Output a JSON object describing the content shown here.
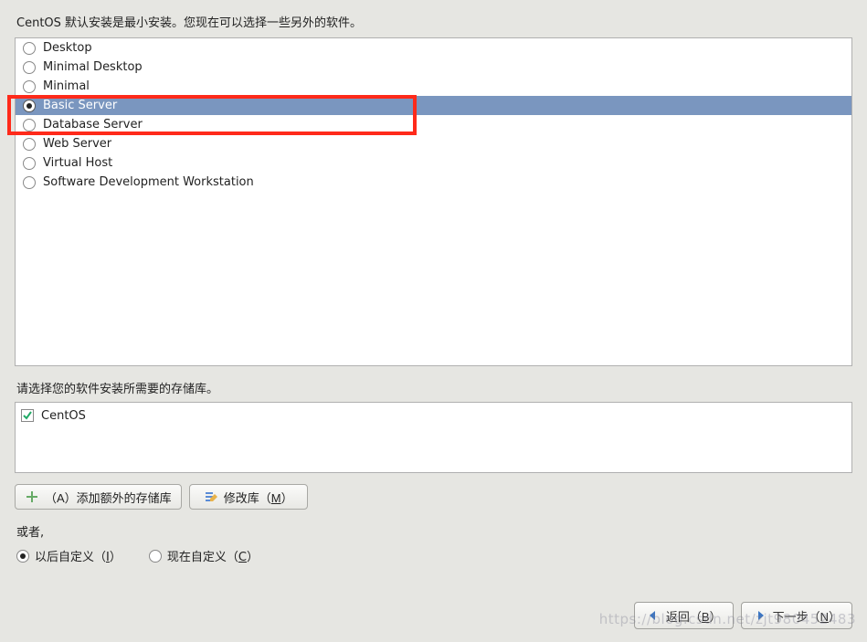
{
  "intro": "CentOS 默认安装是最小安装。您现在可以选择一些另外的软件。",
  "packages": {
    "selectedIndex": 3,
    "items": [
      {
        "label": "Desktop"
      },
      {
        "label": "Minimal Desktop"
      },
      {
        "label": "Minimal"
      },
      {
        "label": "Basic Server"
      },
      {
        "label": "Database Server"
      },
      {
        "label": "Web Server"
      },
      {
        "label": "Virtual Host"
      },
      {
        "label": "Software Development Workstation"
      }
    ]
  },
  "repo_prompt": "请选择您的软件安装所需要的存储库。",
  "repos": [
    {
      "label": "CentOS",
      "checked": true
    }
  ],
  "buttons": {
    "add_repo": "（A）添加额外的存储库",
    "modify_repo_pre": "修改库（",
    "modify_repo_key": "M",
    "modify_repo_post": "）"
  },
  "or_label": "或者,",
  "customize": {
    "later_pre": "以后自定义（",
    "later_key": "I",
    "later_post": "）",
    "now_pre": "现在自定义（",
    "now_key": "C",
    "now_post": "）",
    "selected": "later"
  },
  "nav": {
    "back_pre": "返回（",
    "back_key": "B",
    "back_post": "）",
    "next_pre": "下一步（",
    "next_key": "N",
    "next_post": "）"
  },
  "watermark": "https://blog.csdn.net/zjt980452483"
}
